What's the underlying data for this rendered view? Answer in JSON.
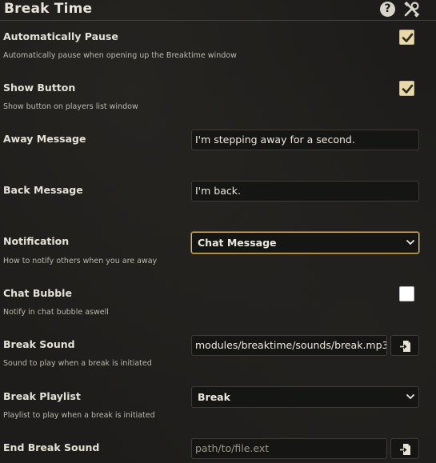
{
  "header": {
    "title": "Break Time",
    "help_glyph": "?",
    "help_icon": "question-circle-icon",
    "tools_icon": "tools-icon"
  },
  "settings": {
    "auto_pause": {
      "label": "Automatically Pause",
      "hint": "Automatically pause when opening up the Breaktime window",
      "checked": true
    },
    "show_button": {
      "label": "Show Button",
      "hint": "Show button on players list window",
      "checked": true
    },
    "away_message": {
      "label": "Away Message",
      "value": "I'm stepping away for a second."
    },
    "back_message": {
      "label": "Back Message",
      "value": "I'm back."
    },
    "notification": {
      "label": "Notification",
      "hint": "How to notify others when you are away",
      "selected": "Chat Message"
    },
    "chat_bubble": {
      "label": "Chat Bubble",
      "hint": "Notify in chat bubble aswell",
      "checked": false
    },
    "break_sound": {
      "label": "Break Sound",
      "hint": "Sound to play when a break is initiated",
      "value": "modules/breaktime/sounds/break.mp3",
      "button_icon": "file-picker-icon"
    },
    "break_playlist": {
      "label": "Break Playlist",
      "hint": "Playlist to play when a break is initiated",
      "selected": "Break"
    },
    "end_break_sound": {
      "label": "End Break Sound",
      "placeholder": "path/to/file.ext",
      "button_icon": "file-picker-icon"
    }
  },
  "colors": {
    "accent_border": "#7a2a1c",
    "checkbox_checked": "#e8d9a6",
    "focus_outline": "#d9b86a"
  }
}
